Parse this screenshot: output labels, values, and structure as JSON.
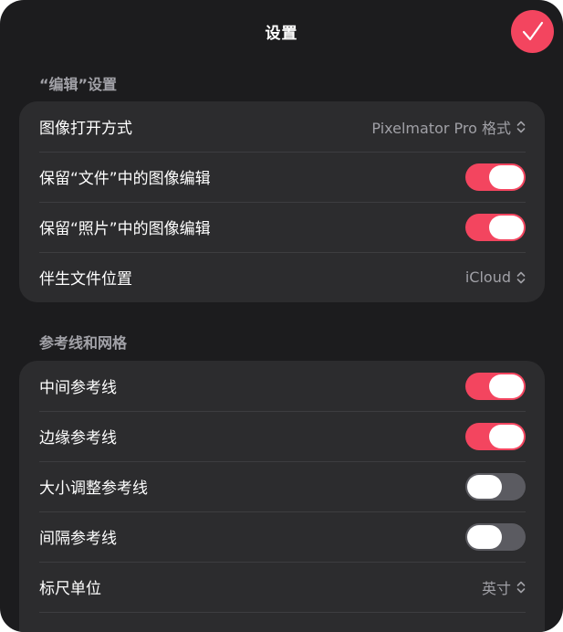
{
  "header": {
    "title": "设置"
  },
  "sections": [
    {
      "title": "“编辑”设置",
      "rows": [
        {
          "label": "图像打开方式",
          "value": "Pixelmator Pro 格式"
        },
        {
          "label": "保留“文件”中的图像编辑",
          "toggle": "on"
        },
        {
          "label": "保留“照片”中的图像编辑",
          "toggle": "on"
        },
        {
          "label": "伴生文件位置",
          "value": "iCloud"
        }
      ]
    },
    {
      "title": "参考线和网格",
      "rows": [
        {
          "label": "中间参考线",
          "toggle": "on"
        },
        {
          "label": "边缘参考线",
          "toggle": "on"
        },
        {
          "label": "大小调整参考线",
          "toggle": "off"
        },
        {
          "label": "间隔参考线",
          "toggle": "off"
        },
        {
          "label": "标尺单位",
          "value": "英寸"
        }
      ]
    }
  ],
  "colors": {
    "accent": "#f3455f",
    "background": "#1c1c1e",
    "group": "#2c2c2e"
  }
}
